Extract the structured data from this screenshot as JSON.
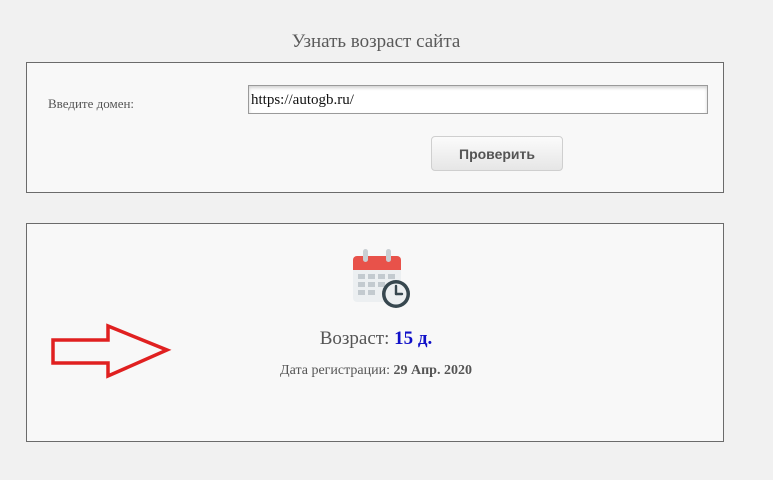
{
  "page": {
    "title": "Узнать возраст сайта"
  },
  "form": {
    "domain_label": "Введите домен:",
    "domain_value": "https://autogb.ru/",
    "check_button_label": "Проверить"
  },
  "result": {
    "age_label": "Возраст: ",
    "age_value": "15 д.",
    "registration_label": "Дата регистрации: ",
    "registration_value": "29 Апр. 2020",
    "icon": "calendar-clock-icon"
  },
  "annotation": {
    "icon": "red-arrow-icon",
    "color": "#e02020"
  },
  "colors": {
    "background": "#f1f1f1",
    "panel_background": "#f8f8f8",
    "panel_border": "#6b6b6b",
    "age_value": "#1010c8",
    "calendar_red": "#e8524a",
    "clock_dark": "#37474f"
  }
}
